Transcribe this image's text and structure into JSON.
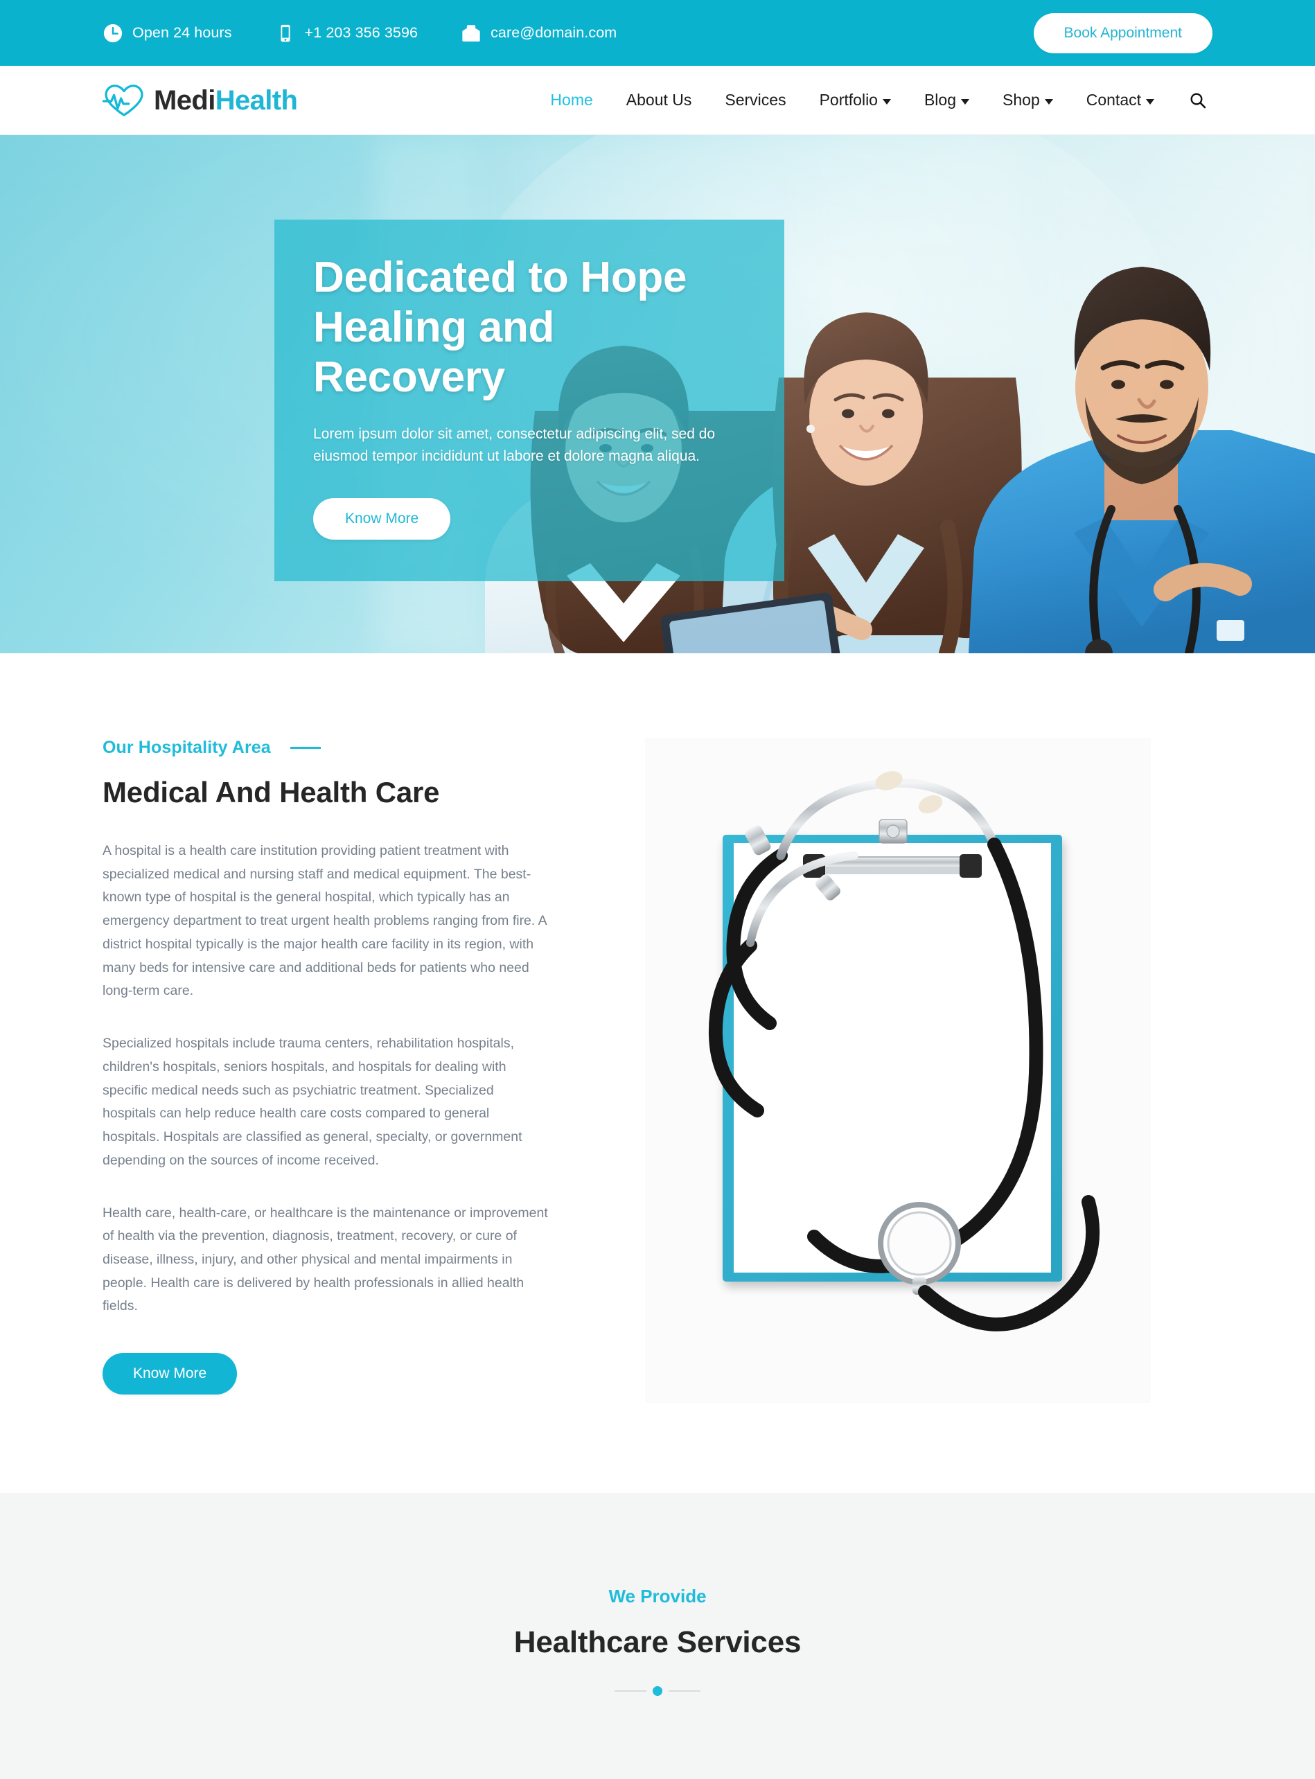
{
  "topbar": {
    "hours": {
      "icon": "clock-icon",
      "text": "Open 24 hours"
    },
    "phone": {
      "icon": "mobile-phone-icon",
      "text": "+1 203 356 3596"
    },
    "email": {
      "icon": "envelope-icon",
      "text": "care@domain.com"
    },
    "cta_label": "Book Appointment",
    "bg_color": "#0bb2cd",
    "cta_text_color": "#22b4d4"
  },
  "brand": {
    "logo_icon": "heart-heartbeat-icon",
    "name_part1": "Medi",
    "name_part2": "Health",
    "color_part1": "#2b2b2b",
    "color_part2": "#1fb6d6"
  },
  "nav": {
    "items": [
      {
        "label": "Home",
        "active": true,
        "dropdown": false
      },
      {
        "label": "About Us",
        "active": false,
        "dropdown": false
      },
      {
        "label": "Services",
        "active": false,
        "dropdown": false
      },
      {
        "label": "Portfolio",
        "active": false,
        "dropdown": true
      },
      {
        "label": "Blog",
        "active": false,
        "dropdown": true
      },
      {
        "label": "Shop",
        "active": false,
        "dropdown": true
      },
      {
        "label": "Contact",
        "active": false,
        "dropdown": true
      }
    ],
    "search_icon": "search-icon",
    "active_color": "#22c1e0"
  },
  "hero": {
    "title_line1": "Dedicated to Hope",
    "title_line2": "Healing and Recovery",
    "subtitle": "Lorem ipsum dolor sit amet, consectetur adipiscing elit, sed do eiusmod tempor incididunt ut labore et dolore magna aliqua.",
    "button_label": "Know More",
    "overlay_color": "#26bace",
    "button_text_color": "#21b8d6"
  },
  "about": {
    "eyebrow": "Our Hospitality Area",
    "title": "Medical And Health Care",
    "paragraph1": "A hospital is a health care institution providing patient treatment with specialized medical and nursing staff and medical equipment. The best-known type of hospital is the general hospital, which typically has an emergency department to treat urgent health problems ranging from fire. A district hospital typically is the major health care facility in its region, with many beds for intensive care and additional beds for patients who need long-term care.",
    "paragraph2": "Specialized hospitals include trauma centers, rehabilitation hospitals, children's hospitals, seniors hospitals, and hospitals for dealing with specific medical needs such as psychiatric treatment. Specialized hospitals can help reduce health care costs compared to general hospitals. Hospitals are classified as general, specialty, or government depending on the sources of income received.",
    "paragraph3": "Health care, health-care, or healthcare is the maintenance or improvement of health via the prevention, diagnosis, treatment, recovery, or cure of disease, illness, injury, and other physical and mental impairments in people. Health care is delivered by health professionals in allied health fields.",
    "button_label": "Know More",
    "image_alt_icon": "clipboard-stethoscope-image",
    "accent_color": "#1fbcda",
    "button_bg": "#12b5d3"
  },
  "services": {
    "eyebrow": "We Provide",
    "title": "Healthcare Services",
    "divider_dot_color": "#1fbcda",
    "bg_color": "#f4f5f5"
  }
}
